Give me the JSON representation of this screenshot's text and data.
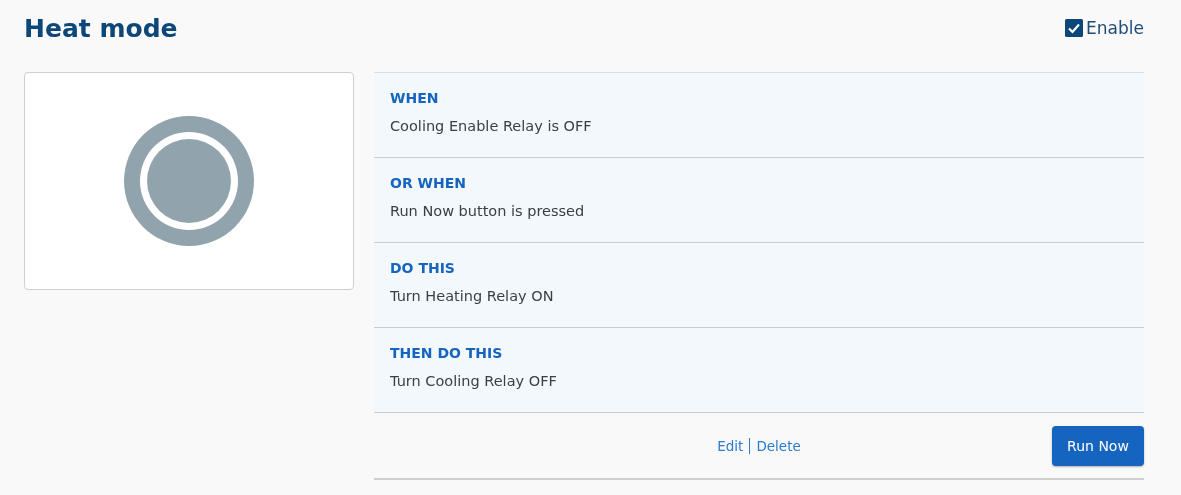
{
  "title": "Heat mode",
  "enable": {
    "label": "Enable",
    "checked": true
  },
  "rules": [
    {
      "heading": "WHEN",
      "text": "Cooling Enable Relay is OFF"
    },
    {
      "heading": "OR WHEN",
      "text": "Run Now button is pressed"
    },
    {
      "heading": "DO THIS",
      "text": "Turn Heating Relay ON"
    },
    {
      "heading": "THEN DO THIS",
      "text": "Turn Cooling Relay OFF"
    }
  ],
  "links": [
    "Edit",
    "Delete"
  ],
  "run_button": "Run Now"
}
